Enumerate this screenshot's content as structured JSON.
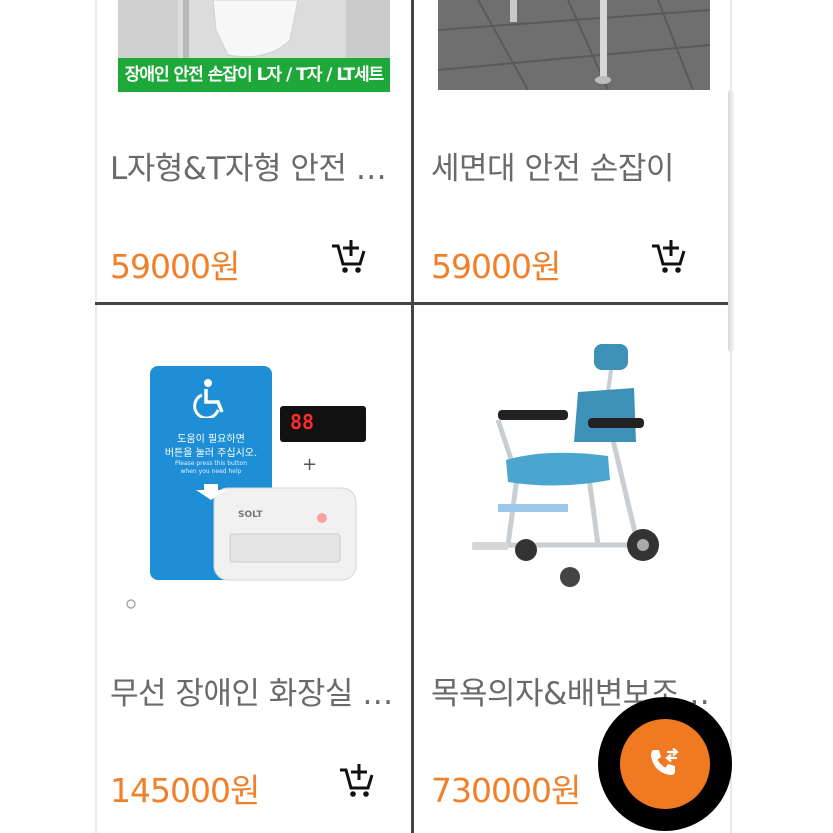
{
  "colors": {
    "price": "#f0802c",
    "fab": "#f07a22",
    "divider": "#444444",
    "banner_green": "#1fa83a"
  },
  "products": [
    {
      "title": "L자형&T자형 안전 …",
      "price": "59000원",
      "image_caption": "장애인 안전 손잡이 L자 / T자 / LT세트",
      "cart_icon": "add-to-cart-icon"
    },
    {
      "title": "세면대 안전 손잡이",
      "price": "59000원",
      "cart_icon": "add-to-cart-icon"
    },
    {
      "title": "무선 장애인 화장실 …",
      "price": "145000원",
      "cart_icon": "add-to-cart-icon",
      "image_text": {
        "panel_line1": "도움이 필요하면",
        "panel_line2": "버튼을 눌러 주십시오.",
        "panel_line3": "Please press this button",
        "panel_line4": "when you need help",
        "display_digits": "88",
        "plus": "+",
        "brand": "SOLT"
      }
    },
    {
      "title": "목욕의자&배변보조…",
      "price": "730000원",
      "cart_icon": "add-to-cart-icon"
    }
  ],
  "fab": {
    "icon": "call-transfer-icon"
  }
}
